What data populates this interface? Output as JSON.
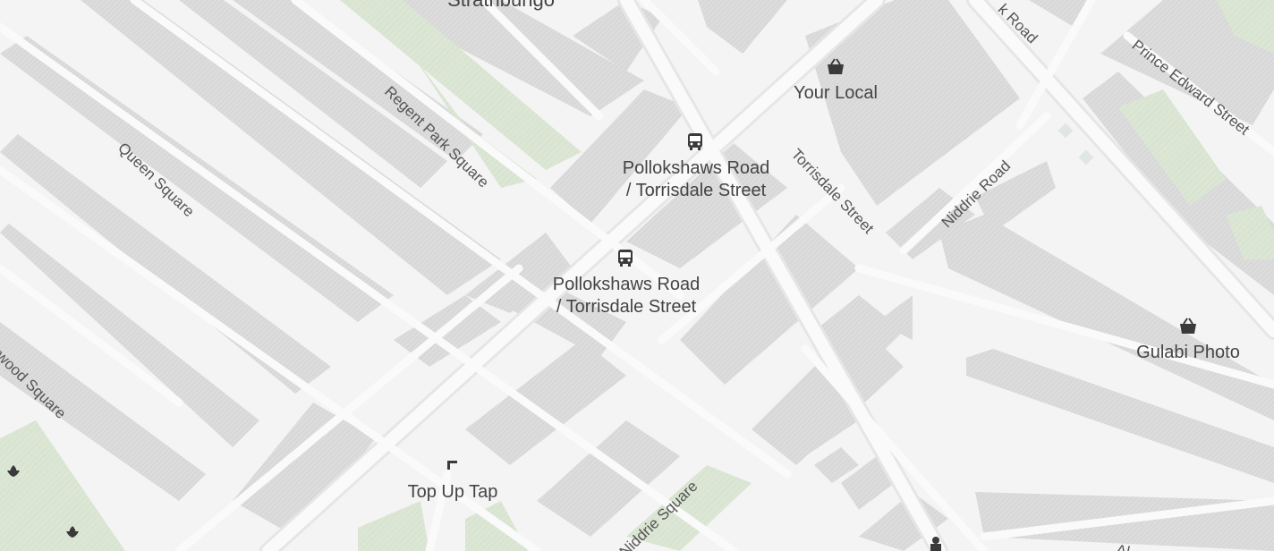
{
  "map": {
    "area_label": "Strathbungo",
    "colors": {
      "background": "#f4f4f4",
      "block": "#dcdcdc",
      "block_hatch": "#d0d0d0",
      "park": "#dbe6d4",
      "road": "#fafafa",
      "road_casing": "#e2e2e2",
      "text": "#444444"
    },
    "pois": [
      {
        "id": "your-local",
        "label": "Your Local",
        "icon": "shopping-basket-icon"
      },
      {
        "id": "bus-stop-1",
        "label": "Pollokshaws Road\n/ Torrisdale Street",
        "icon": "bus-icon"
      },
      {
        "id": "bus-stop-2",
        "label": "Pollokshaws Road\n/ Torrisdale Street",
        "icon": "bus-icon"
      },
      {
        "id": "gulabi-photo",
        "label": "Gulabi Photo",
        "icon": "shopping-basket-icon"
      },
      {
        "id": "top-up-tap",
        "label": "Top Up Tap",
        "icon": "water-tap-icon"
      }
    ],
    "streets": [
      {
        "id": "regent-park-square",
        "label": "Regent Park Square"
      },
      {
        "id": "queen-square",
        "label": "Queen Square"
      },
      {
        "id": "torrisdale-street",
        "label": "Torrisdale Street"
      },
      {
        "id": "niddrie-road",
        "label": "Niddrie Road"
      },
      {
        "id": "prince-edward-street",
        "label": "Prince Edward Street"
      },
      {
        "id": "k-road",
        "label": "k Road"
      },
      {
        "id": "wood-square",
        "label": "ywood Square"
      },
      {
        "id": "niddrie-square",
        "label": "Niddrie Square"
      },
      {
        "id": "al-partial",
        "label": "Al"
      }
    ]
  }
}
